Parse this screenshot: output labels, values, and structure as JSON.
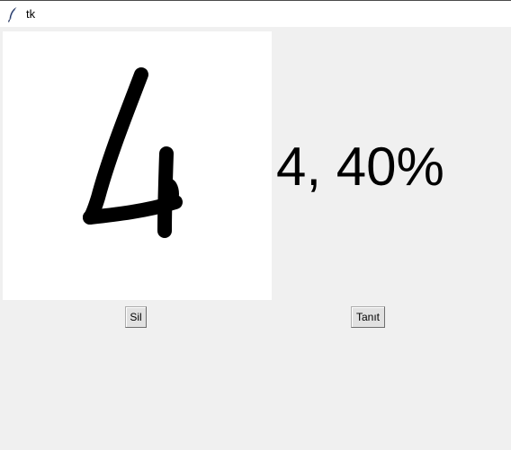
{
  "window": {
    "title": "tk"
  },
  "canvas": {
    "drawn_digit": "4"
  },
  "prediction": {
    "text": "4, 40%"
  },
  "buttons": {
    "clear_label": "Sil",
    "recognize_label": "Tanıt"
  },
  "icons": {
    "app": "tk-feather-icon"
  },
  "colors": {
    "window_bg": "#f0f0f0",
    "canvas_bg": "#ffffff",
    "ink": "#000000",
    "titlebar_bg": "#ffffff"
  }
}
